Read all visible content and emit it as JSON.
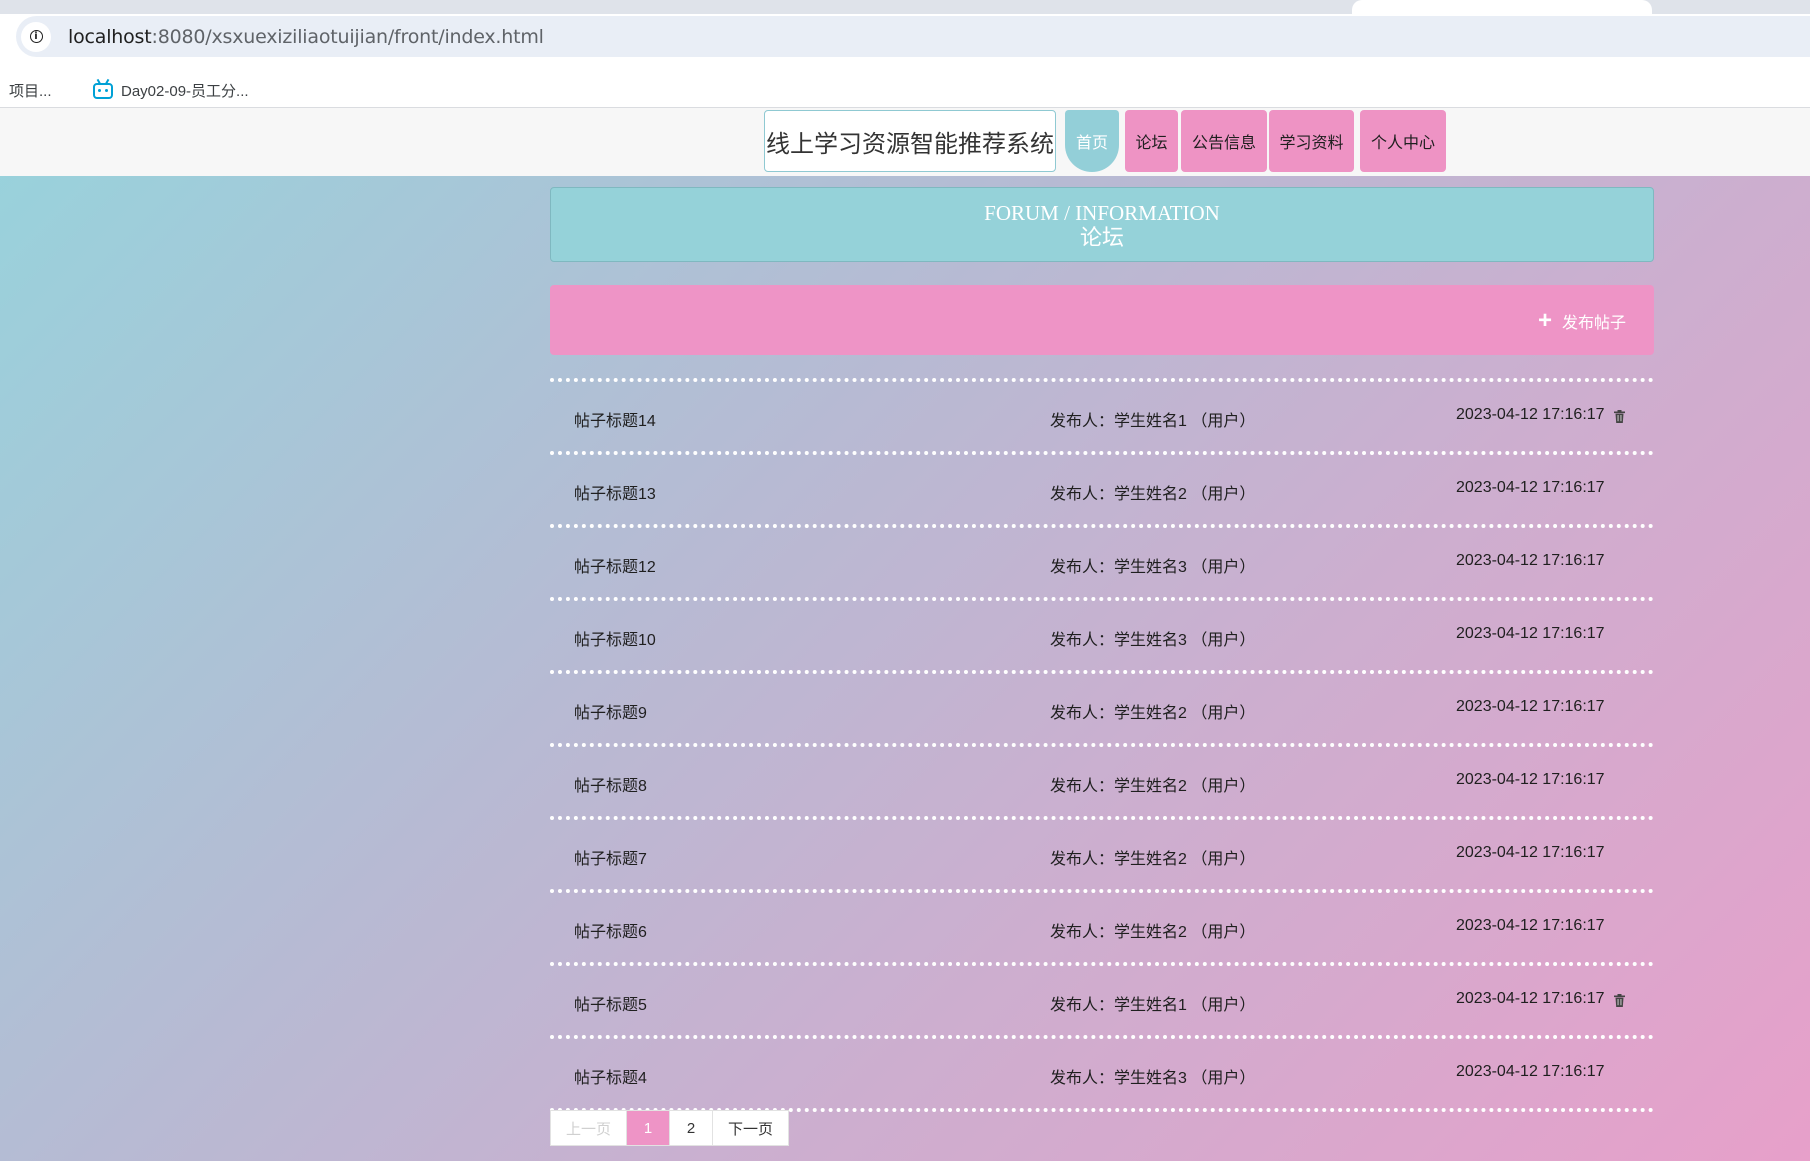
{
  "browser": {
    "url_host": "localhost",
    "url_rest": ":8080/xsxuexiziliaotuijian/front/index.html",
    "bookmarks": [
      {
        "label": "】项目..."
      },
      {
        "label": "Day02-09-员工分..."
      }
    ]
  },
  "site": {
    "brand": "线上学习资源智能推荐系统",
    "nav": [
      {
        "label": "首页",
        "active": true
      },
      {
        "label": "论坛",
        "active": false
      },
      {
        "label": "公告信息",
        "active": false
      },
      {
        "label": "学习资料",
        "active": false
      },
      {
        "label": "个人中心",
        "active": false
      }
    ]
  },
  "forum": {
    "title_en": "FORUM / INFORMATION",
    "title_zh": "论坛",
    "publish_label": "发布帖子",
    "posts": [
      {
        "title": "帖子标题14",
        "author": "发布人：学生姓名1 （用户）",
        "time": "2023-04-12 17:16:17",
        "deletable": true
      },
      {
        "title": "帖子标题13",
        "author": "发布人：学生姓名2 （用户）",
        "time": "2023-04-12 17:16:17",
        "deletable": false
      },
      {
        "title": "帖子标题12",
        "author": "发布人：学生姓名3 （用户）",
        "time": "2023-04-12 17:16:17",
        "deletable": false
      },
      {
        "title": "帖子标题10",
        "author": "发布人：学生姓名3 （用户）",
        "time": "2023-04-12 17:16:17",
        "deletable": false
      },
      {
        "title": "帖子标题9",
        "author": "发布人：学生姓名2 （用户）",
        "time": "2023-04-12 17:16:17",
        "deletable": false
      },
      {
        "title": "帖子标题8",
        "author": "发布人：学生姓名2 （用户）",
        "time": "2023-04-12 17:16:17",
        "deletable": false
      },
      {
        "title": "帖子标题7",
        "author": "发布人：学生姓名2 （用户）",
        "time": "2023-04-12 17:16:17",
        "deletable": false
      },
      {
        "title": "帖子标题6",
        "author": "发布人：学生姓名2 （用户）",
        "time": "2023-04-12 17:16:17",
        "deletable": false
      },
      {
        "title": "帖子标题5",
        "author": "发布人：学生姓名1 （用户）",
        "time": "2023-04-12 17:16:17",
        "deletable": true
      },
      {
        "title": "帖子标题4",
        "author": "发布人：学生姓名3 （用户）",
        "time": "2023-04-12 17:16:17",
        "deletable": false
      }
    ]
  },
  "pagination": {
    "prev": "上一页",
    "pages": [
      "1",
      "2"
    ],
    "current": "1",
    "next": "下一页"
  },
  "colors": {
    "accent_pink": "#ee94c6",
    "accent_teal": "#95d2d9"
  }
}
